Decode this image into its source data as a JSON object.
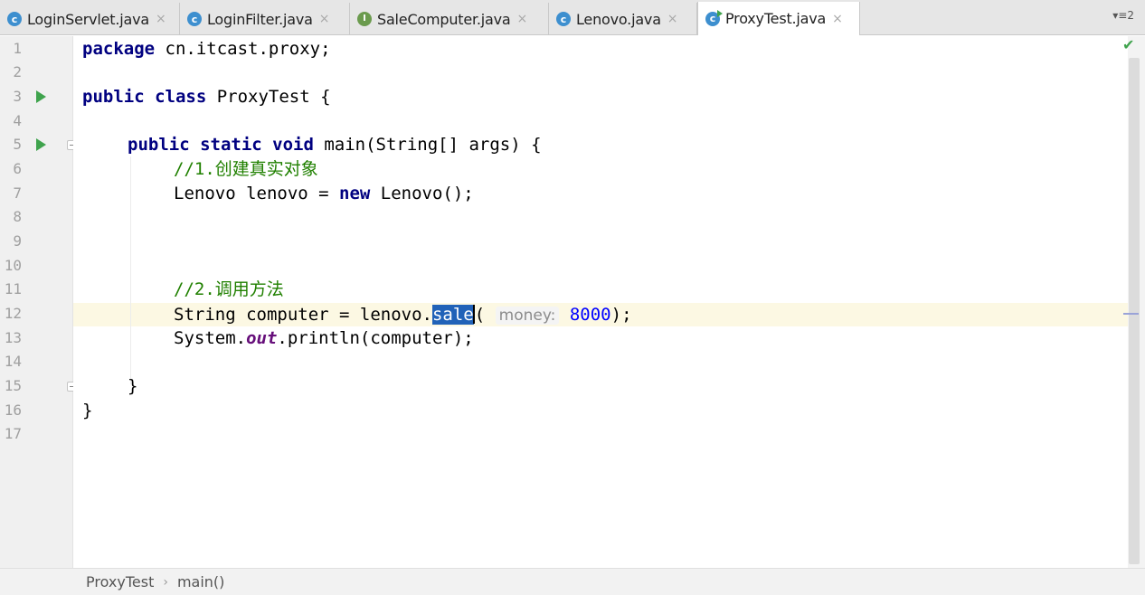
{
  "tabs": [
    {
      "name": "LoginServlet.java",
      "icon": "class-icon",
      "glyph": "c"
    },
    {
      "name": "LoginFilter.java",
      "icon": "class-icon",
      "glyph": "c"
    },
    {
      "name": "SaleComputer.java",
      "icon": "interface-icon",
      "glyph": "I"
    },
    {
      "name": "Lenovo.java",
      "icon": "class-icon",
      "glyph": "c"
    },
    {
      "name": "ProxyTest.java",
      "icon": "runnable-class-icon",
      "glyph": "c",
      "active": true
    }
  ],
  "tab_close": "×",
  "tab_menu": "▾≡2",
  "line_numbers": [
    "1",
    "2",
    "3",
    "4",
    "5",
    "6",
    "7",
    "8",
    "9",
    "10",
    "11",
    "12",
    "13",
    "14",
    "15",
    "16",
    "17"
  ],
  "code": {
    "l1_kw": "package",
    "l1_rest": " cn.itcast.proxy;",
    "l3_kw": "public class",
    "l3_rest": " ProxyTest {",
    "l5_kw": "public static void",
    "l5_rest": " main(String[] args) {",
    "l6_comment": "//1.创建真实对象",
    "l7_a": "Lenovo lenovo = ",
    "l7_kw": "new",
    "l7_b": " Lenovo();",
    "l11_comment": "//2.调用方法",
    "l12_a": "String computer = lenovo.",
    "l12_sel": "sale",
    "l12_b": "(",
    "l12_hint": "money:",
    "l12_num": "8000",
    "l12_c": ");",
    "l13_a": "System.",
    "l13_field": "out",
    "l13_b": ".println(computer);",
    "l15": "}",
    "l16": "}"
  },
  "status_check": "✔",
  "breadcrumb": {
    "class": "ProxyTest",
    "sep": "›",
    "method": "main()"
  },
  "colors": {
    "keyword": "#000080",
    "comment": "#208000",
    "number": "#0000ff",
    "selection": "#2162b8",
    "current_line": "#fcf8e3"
  }
}
